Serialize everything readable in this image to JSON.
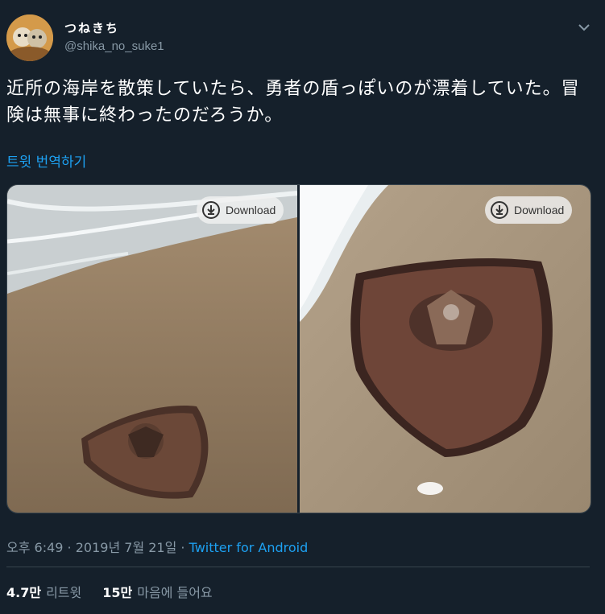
{
  "user": {
    "display_name": "つねきち",
    "handle": "@shika_no_suke1"
  },
  "tweet": {
    "text": "近所の海岸を散策していたら、勇者の盾っぽいのが漂着していた。冒険は無事に終わったのだろうか。",
    "translate_label": "트윗 번역하기"
  },
  "media": {
    "download_label_1": "Download",
    "download_label_2": "Download"
  },
  "meta": {
    "time": "오후 6:49",
    "separator": " · ",
    "date": "2019년 7월 21일",
    "source": "Twitter for Android"
  },
  "stats": {
    "retweets_count": "4.7만",
    "retweets_label": "리트윗",
    "likes_count": "15만",
    "likes_label": "마음에 들어요"
  }
}
